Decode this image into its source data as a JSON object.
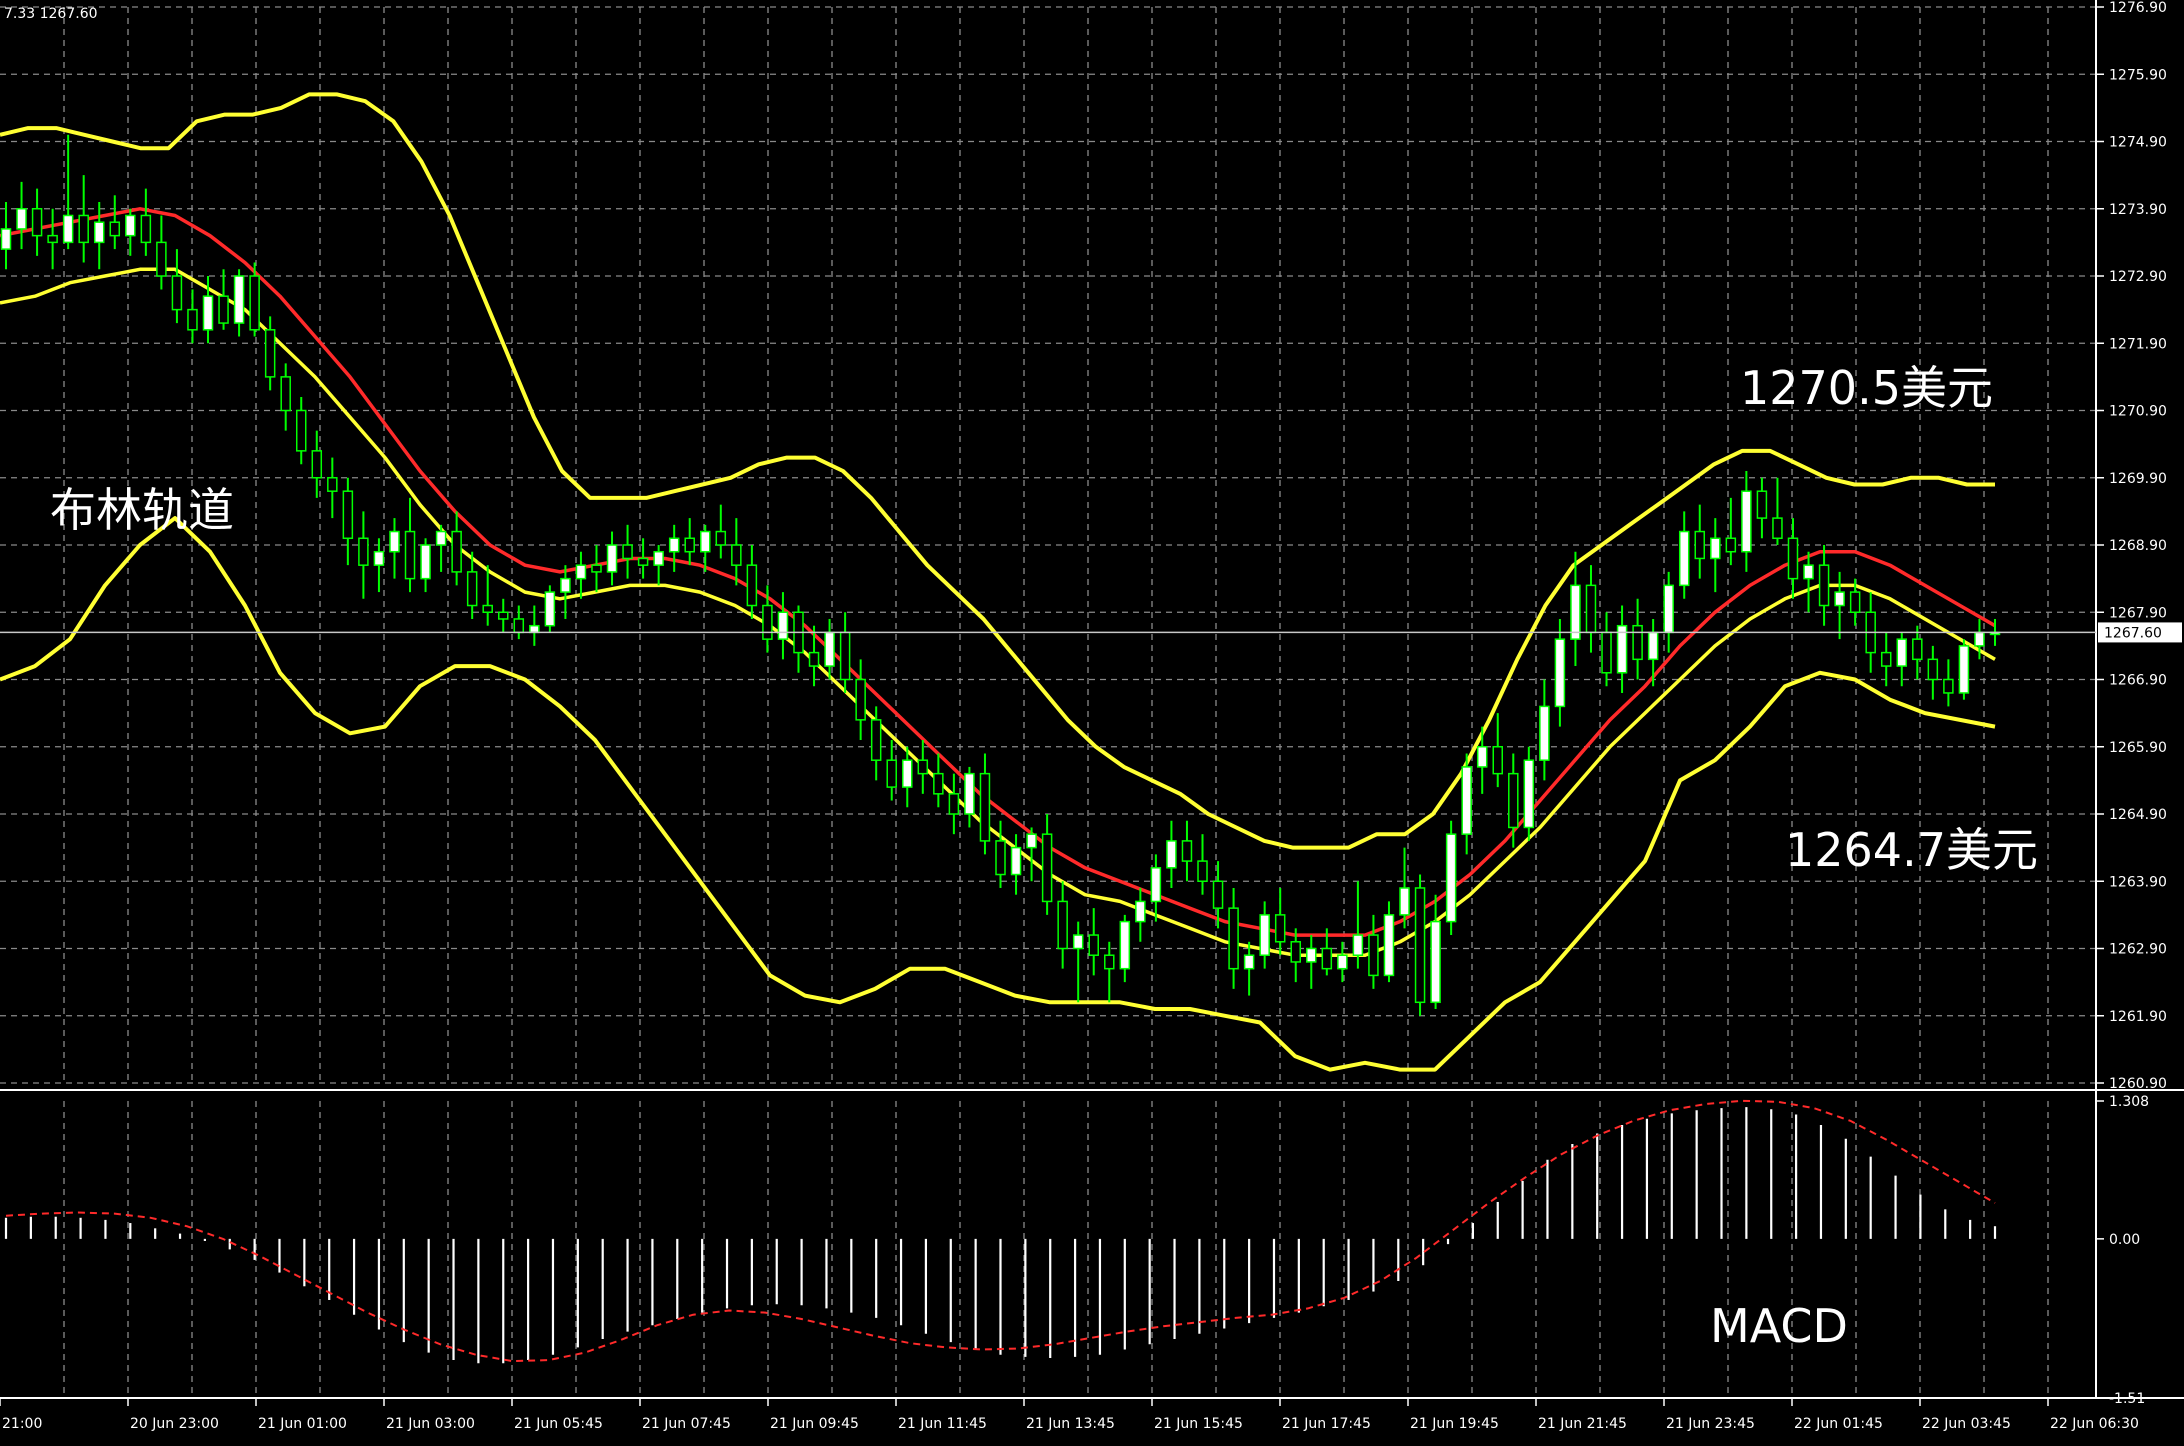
{
  "symbol_header": "7.33 1267.60",
  "chart_data": [
    {
      "type": "candlestick",
      "indicator": "Bollinger Bands",
      "price_axis": {
        "ticks": [
          "1276.90",
          "1275.90",
          "1274.90",
          "1273.90",
          "1272.90",
          "1271.90",
          "1270.90",
          "1269.90",
          "1268.90",
          "1267.90",
          "1266.90",
          "1265.90",
          "1264.90",
          "1263.90",
          "1262.90",
          "1261.90",
          "1260.90"
        ],
        "ylim": [
          1260.9,
          1276.9
        ]
      },
      "current_price": 1267.6,
      "current_price_label": "1267.60",
      "annotations": {
        "bollinger_label": "布林轨道",
        "upper_level": "1270.5美元",
        "lower_level": "1264.7美元"
      },
      "candles": [
        [
          1273.3,
          1274.0,
          1273.0,
          1273.6
        ],
        [
          1273.6,
          1274.3,
          1273.3,
          1273.9
        ],
        [
          1273.9,
          1274.2,
          1273.2,
          1273.5
        ],
        [
          1273.5,
          1273.9,
          1273.0,
          1273.4
        ],
        [
          1273.4,
          1275.0,
          1273.3,
          1273.8
        ],
        [
          1273.8,
          1274.4,
          1273.1,
          1273.4
        ],
        [
          1273.4,
          1274.0,
          1273.0,
          1273.7
        ],
        [
          1273.7,
          1274.1,
          1273.3,
          1273.5
        ],
        [
          1273.5,
          1273.9,
          1273.2,
          1273.8
        ],
        [
          1273.8,
          1274.2,
          1273.2,
          1273.4
        ],
        [
          1273.4,
          1273.8,
          1272.7,
          1272.9
        ],
        [
          1272.9,
          1273.3,
          1272.2,
          1272.4
        ],
        [
          1272.4,
          1272.7,
          1271.9,
          1272.1
        ],
        [
          1272.1,
          1272.9,
          1271.9,
          1272.6
        ],
        [
          1272.6,
          1273.0,
          1272.1,
          1272.2
        ],
        [
          1272.2,
          1273.0,
          1272.0,
          1272.9
        ],
        [
          1272.9,
          1273.1,
          1272.0,
          1272.1
        ],
        [
          1272.1,
          1272.3,
          1271.2,
          1271.4
        ],
        [
          1271.4,
          1271.6,
          1270.6,
          1270.9
        ],
        [
          1270.9,
          1271.1,
          1270.1,
          1270.3
        ],
        [
          1270.3,
          1270.6,
          1269.6,
          1269.9
        ],
        [
          1269.9,
          1270.2,
          1269.3,
          1269.7
        ],
        [
          1269.7,
          1269.9,
          1268.6,
          1269.0
        ],
        [
          1269.0,
          1269.4,
          1268.1,
          1268.6
        ],
        [
          1268.6,
          1269.0,
          1268.2,
          1268.8
        ],
        [
          1268.8,
          1269.3,
          1268.4,
          1269.1
        ],
        [
          1269.1,
          1269.6,
          1268.2,
          1268.4
        ],
        [
          1268.4,
          1269.0,
          1268.2,
          1268.9
        ],
        [
          1268.9,
          1269.2,
          1268.5,
          1269.1
        ],
        [
          1269.1,
          1269.4,
          1268.3,
          1268.5
        ],
        [
          1268.5,
          1268.8,
          1267.8,
          1268.0
        ],
        [
          1268.0,
          1268.6,
          1267.7,
          1267.9
        ],
        [
          1267.9,
          1268.1,
          1267.6,
          1267.8
        ],
        [
          1267.8,
          1268.0,
          1267.5,
          1267.6
        ],
        [
          1267.6,
          1268.0,
          1267.4,
          1267.7
        ],
        [
          1267.7,
          1268.3,
          1267.6,
          1268.2
        ],
        [
          1268.2,
          1268.6,
          1267.8,
          1268.4
        ],
        [
          1268.4,
          1268.8,
          1268.1,
          1268.6
        ],
        [
          1268.6,
          1268.9,
          1268.2,
          1268.5
        ],
        [
          1268.5,
          1269.1,
          1268.3,
          1268.9
        ],
        [
          1268.9,
          1269.2,
          1268.4,
          1268.7
        ],
        [
          1268.7,
          1269.0,
          1268.4,
          1268.6
        ],
        [
          1268.6,
          1268.9,
          1268.3,
          1268.8
        ],
        [
          1268.8,
          1269.2,
          1268.5,
          1269.0
        ],
        [
          1269.0,
          1269.3,
          1268.6,
          1268.8
        ],
        [
          1268.8,
          1269.2,
          1268.5,
          1269.1
        ],
        [
          1269.1,
          1269.5,
          1268.7,
          1268.9
        ],
        [
          1268.9,
          1269.3,
          1268.3,
          1268.6
        ],
        [
          1268.6,
          1268.9,
          1267.8,
          1268.0
        ],
        [
          1268.0,
          1268.3,
          1267.3,
          1267.5
        ],
        [
          1267.5,
          1268.2,
          1267.2,
          1267.9
        ],
        [
          1267.9,
          1268.0,
          1267.0,
          1267.3
        ],
        [
          1267.3,
          1267.7,
          1266.8,
          1267.1
        ],
        [
          1267.1,
          1267.8,
          1266.9,
          1267.6
        ],
        [
          1267.6,
          1267.9,
          1266.7,
          1266.9
        ],
        [
          1266.9,
          1267.2,
          1266.0,
          1266.3
        ],
        [
          1266.3,
          1266.5,
          1265.4,
          1265.7
        ],
        [
          1265.7,
          1266.0,
          1265.1,
          1265.3
        ],
        [
          1265.3,
          1265.9,
          1265.0,
          1265.7
        ],
        [
          1265.7,
          1266.0,
          1265.2,
          1265.5
        ],
        [
          1265.5,
          1265.8,
          1265.0,
          1265.2
        ],
        [
          1265.2,
          1265.5,
          1264.6,
          1264.9
        ],
        [
          1264.9,
          1265.6,
          1264.7,
          1265.5
        ],
        [
          1265.5,
          1265.8,
          1264.3,
          1264.5
        ],
        [
          1264.5,
          1264.8,
          1263.8,
          1264.0
        ],
        [
          1264.0,
          1264.6,
          1263.7,
          1264.4
        ],
        [
          1264.4,
          1264.7,
          1263.9,
          1264.6
        ],
        [
          1264.6,
          1264.9,
          1263.4,
          1263.6
        ],
        [
          1263.6,
          1263.9,
          1262.6,
          1262.9
        ],
        [
          1262.9,
          1263.3,
          1262.1,
          1263.1
        ],
        [
          1263.1,
          1263.5,
          1262.5,
          1262.8
        ],
        [
          1262.8,
          1263.0,
          1262.1,
          1262.6
        ],
        [
          1262.6,
          1263.4,
          1262.4,
          1263.3
        ],
        [
          1263.3,
          1263.8,
          1263.0,
          1263.6
        ],
        [
          1263.6,
          1264.3,
          1263.3,
          1264.1
        ],
        [
          1264.1,
          1264.8,
          1263.8,
          1264.5
        ],
        [
          1264.5,
          1264.8,
          1263.9,
          1264.2
        ],
        [
          1264.2,
          1264.6,
          1263.7,
          1263.9
        ],
        [
          1263.9,
          1264.2,
          1263.2,
          1263.5
        ],
        [
          1263.5,
          1263.8,
          1262.3,
          1262.6
        ],
        [
          1262.6,
          1263.0,
          1262.2,
          1262.8
        ],
        [
          1262.8,
          1263.6,
          1262.6,
          1263.4
        ],
        [
          1263.4,
          1263.8,
          1262.8,
          1263.0
        ],
        [
          1263.0,
          1263.2,
          1262.4,
          1262.7
        ],
        [
          1262.7,
          1263.1,
          1262.3,
          1262.9
        ],
        [
          1262.9,
          1263.2,
          1262.5,
          1262.6
        ],
        [
          1262.6,
          1263.0,
          1262.4,
          1262.8
        ],
        [
          1262.8,
          1263.9,
          1262.6,
          1263.1
        ],
        [
          1263.1,
          1263.4,
          1262.3,
          1262.5
        ],
        [
          1262.5,
          1263.6,
          1262.4,
          1263.4
        ],
        [
          1263.4,
          1264.4,
          1263.2,
          1263.8
        ],
        [
          1263.8,
          1264.0,
          1261.9,
          1262.1
        ],
        [
          1262.1,
          1263.7,
          1262.0,
          1263.3
        ],
        [
          1263.3,
          1264.8,
          1263.1,
          1264.6
        ],
        [
          1264.6,
          1265.8,
          1264.3,
          1265.6
        ],
        [
          1265.6,
          1266.2,
          1265.2,
          1265.9
        ],
        [
          1265.9,
          1266.4,
          1265.3,
          1265.5
        ],
        [
          1265.5,
          1265.8,
          1264.4,
          1264.7
        ],
        [
          1264.7,
          1265.9,
          1264.5,
          1265.7
        ],
        [
          1265.7,
          1266.9,
          1265.4,
          1266.5
        ],
        [
          1266.5,
          1267.8,
          1266.2,
          1267.5
        ],
        [
          1267.5,
          1268.8,
          1267.1,
          1268.3
        ],
        [
          1268.3,
          1268.6,
          1267.3,
          1267.6
        ],
        [
          1267.6,
          1267.9,
          1266.8,
          1267.0
        ],
        [
          1267.0,
          1268.0,
          1266.7,
          1267.7
        ],
        [
          1267.7,
          1268.1,
          1266.9,
          1267.2
        ],
        [
          1267.2,
          1267.8,
          1266.8,
          1267.6
        ],
        [
          1267.6,
          1268.5,
          1267.3,
          1268.3
        ],
        [
          1268.3,
          1269.4,
          1268.1,
          1269.1
        ],
        [
          1269.1,
          1269.5,
          1268.4,
          1268.7
        ],
        [
          1268.7,
          1269.3,
          1268.2,
          1269.0
        ],
        [
          1269.0,
          1269.6,
          1268.6,
          1268.8
        ],
        [
          1268.8,
          1270.0,
          1268.5,
          1269.7
        ],
        [
          1269.7,
          1269.9,
          1269.0,
          1269.3
        ],
        [
          1269.3,
          1269.9,
          1268.9,
          1269.0
        ],
        [
          1269.0,
          1269.3,
          1268.1,
          1268.4
        ],
        [
          1268.4,
          1268.8,
          1267.9,
          1268.6
        ],
        [
          1268.6,
          1268.9,
          1267.7,
          1268.0
        ],
        [
          1268.0,
          1268.5,
          1267.5,
          1268.2
        ],
        [
          1268.2,
          1268.4,
          1267.7,
          1267.9
        ],
        [
          1267.9,
          1268.2,
          1267.0,
          1267.3
        ],
        [
          1267.3,
          1267.6,
          1266.8,
          1267.1
        ],
        [
          1267.1,
          1267.6,
          1266.8,
          1267.5
        ],
        [
          1267.5,
          1267.7,
          1266.9,
          1267.2
        ],
        [
          1267.2,
          1267.4,
          1266.6,
          1266.9
        ],
        [
          1266.9,
          1267.2,
          1266.5,
          1266.7
        ],
        [
          1266.7,
          1267.5,
          1266.6,
          1267.4
        ],
        [
          1267.4,
          1267.8,
          1267.2,
          1267.6
        ],
        [
          1267.6,
          1267.8,
          1267.4,
          1267.6
        ]
      ],
      "upper_band": [
        1275.0,
        1275.1,
        1275.1,
        1275.0,
        1274.9,
        1274.8,
        1274.8,
        1275.2,
        1275.3,
        1275.3,
        1275.4,
        1275.6,
        1275.6,
        1275.5,
        1275.2,
        1274.6,
        1273.8,
        1272.8,
        1271.8,
        1270.8,
        1270.0,
        1269.6,
        1269.6,
        1269.6,
        1269.7,
        1269.8,
        1269.9,
        1270.1,
        1270.2,
        1270.2,
        1270.0,
        1269.6,
        1269.1,
        1268.6,
        1268.2,
        1267.8,
        1267.3,
        1266.8,
        1266.3,
        1265.9,
        1265.6,
        1265.4,
        1265.2,
        1264.9,
        1264.7,
        1264.5,
        1264.4,
        1264.4,
        1264.4,
        1264.6,
        1264.6,
        1264.9,
        1265.5,
        1266.3,
        1267.2,
        1268.0,
        1268.6,
        1268.9,
        1269.2,
        1269.5,
        1269.8,
        1270.1,
        1270.3,
        1270.3,
        1270.1,
        1269.9,
        1269.8,
        1269.8,
        1269.9,
        1269.9,
        1269.8,
        1269.8
      ],
      "middle_band": [
        1273.5,
        1273.6,
        1273.7,
        1273.8,
        1273.9,
        1273.8,
        1273.5,
        1273.1,
        1272.6,
        1272.0,
        1271.4,
        1270.7,
        1270.0,
        1269.4,
        1268.9,
        1268.6,
        1268.5,
        1268.6,
        1268.7,
        1268.7,
        1268.6,
        1268.4,
        1268.1,
        1267.7,
        1267.2,
        1266.7,
        1266.2,
        1265.7,
        1265.2,
        1264.8,
        1264.4,
        1264.1,
        1263.9,
        1263.7,
        1263.5,
        1263.3,
        1263.2,
        1263.1,
        1263.1,
        1263.1,
        1263.3,
        1263.6,
        1264.0,
        1264.5,
        1265.1,
        1265.7,
        1266.3,
        1266.8,
        1267.4,
        1267.9,
        1268.3,
        1268.6,
        1268.8,
        1268.8,
        1268.6,
        1268.3,
        1268.0,
        1267.7
      ],
      "band_gap": [
        1.0,
        1.0,
        0.9,
        0.9,
        0.9,
        0.8,
        0.8,
        0.7,
        0.7,
        0.6,
        0.6,
        0.5,
        0.5,
        0.5,
        0.4,
        0.4,
        0.4,
        0.4,
        0.4,
        0.4,
        0.4,
        0.4,
        0.4,
        0.4,
        0.4,
        0.4,
        0.4,
        0.4,
        0.4,
        0.4,
        0.4,
        0.4,
        0.3,
        0.3,
        0.3,
        0.3,
        0.3,
        0.3,
        0.3,
        0.3,
        0.3,
        0.3,
        0.3,
        0.3,
        0.4,
        0.4,
        0.4,
        0.4,
        0.5,
        0.5,
        0.5,
        0.5,
        0.5,
        0.5,
        0.5,
        0.5,
        0.5,
        0.5
      ],
      "lower_band": [
        1266.9,
        1267.1,
        1267.5,
        1268.3,
        1268.9,
        1269.3,
        1268.8,
        1268.0,
        1267.0,
        1266.4,
        1266.1,
        1266.2,
        1266.8,
        1267.1,
        1267.1,
        1266.9,
        1266.5,
        1266.0,
        1265.3,
        1264.6,
        1263.9,
        1263.2,
        1262.5,
        1262.2,
        1262.1,
        1262.3,
        1262.6,
        1262.6,
        1262.4,
        1262.2,
        1262.1,
        1262.1,
        1262.1,
        1262.0,
        1262.0,
        1261.9,
        1261.8,
        1261.3,
        1261.1,
        1261.2,
        1261.1,
        1261.1,
        1261.6,
        1262.1,
        1262.4,
        1263.0,
        1263.6,
        1264.2,
        1265.4,
        1265.7,
        1266.2,
        1266.8,
        1267.0,
        1266.9,
        1266.6,
        1266.4,
        1266.3,
        1266.2
      ]
    },
    {
      "type": "bar",
      "indicator": "MACD",
      "label": "MACD",
      "ticks": [
        "1.308",
        "0.00",
        "-1.51"
      ],
      "ylim": [
        -1.51,
        1.308
      ],
      "histogram": [
        0.2,
        0.21,
        0.21,
        0.2,
        0.18,
        0.15,
        0.1,
        0.05,
        -0.02,
        -0.1,
        -0.2,
        -0.32,
        -0.45,
        -0.58,
        -0.72,
        -0.86,
        -0.98,
        -1.08,
        -1.15,
        -1.18,
        -1.18,
        -1.15,
        -1.1,
        -1.03,
        -0.95,
        -0.88,
        -0.82,
        -0.76,
        -0.7,
        -0.66,
        -0.63,
        -0.62,
        -0.63,
        -0.66,
        -0.7,
        -0.75,
        -0.82,
        -0.9,
        -0.98,
        -1.05,
        -1.1,
        -1.12,
        -1.13,
        -1.12,
        -1.1,
        -1.05,
        -1.0,
        -0.95,
        -0.9,
        -0.85,
        -0.8,
        -0.75,
        -0.7,
        -0.64,
        -0.58,
        -0.5,
        -0.4,
        -0.25,
        -0.05,
        0.15,
        0.35,
        0.55,
        0.75,
        0.9,
        1.0,
        1.08,
        1.14,
        1.19,
        1.22,
        1.24,
        1.25,
        1.23,
        1.18,
        1.08,
        0.95,
        0.78,
        0.6,
        0.42,
        0.28,
        0.18,
        0.12
      ],
      "signal": [
        0.22,
        0.24,
        0.25,
        0.24,
        0.2,
        0.12,
        0.0,
        -0.16,
        -0.34,
        -0.52,
        -0.7,
        -0.86,
        -1.0,
        -1.1,
        -1.16,
        -1.15,
        -1.08,
        -0.96,
        -0.82,
        -0.72,
        -0.68,
        -0.7,
        -0.76,
        -0.84,
        -0.92,
        -0.99,
        -1.03,
        -1.05,
        -1.04,
        -1.0,
        -0.94,
        -0.88,
        -0.83,
        -0.79,
        -0.75,
        -0.72,
        -0.66,
        -0.56,
        -0.4,
        -0.18,
        0.08,
        0.34,
        0.58,
        0.8,
        0.98,
        1.12,
        1.22,
        1.28,
        1.31,
        1.3,
        1.24,
        1.12,
        0.94,
        0.74,
        0.54,
        0.34
      ]
    }
  ],
  "time_axis": [
    "21:00",
    "20 Jun 23:00",
    "21 Jun 01:00",
    "21 Jun 03:00",
    "21 Jun 05:45",
    "21 Jun 07:45",
    "21 Jun 09:45",
    "21 Jun 11:45",
    "21 Jun 13:45",
    "21 Jun 15:45",
    "21 Jun 17:45",
    "21 Jun 19:45",
    "21 Jun 21:45",
    "21 Jun 23:45",
    "22 Jun 01:45",
    "22 Jun 03:45",
    "22 Jun 06:30"
  ],
  "colors": {
    "background": "#000000",
    "grid": "#8a8a8a",
    "bull_candle": "#ffffff",
    "bear_candle": "#000000",
    "wick": "#00ff00",
    "band": "#ffff33",
    "middle": "#ff2a2a",
    "axis_line": "#ffffff",
    "macd_signal": "#ff2a2a"
  }
}
